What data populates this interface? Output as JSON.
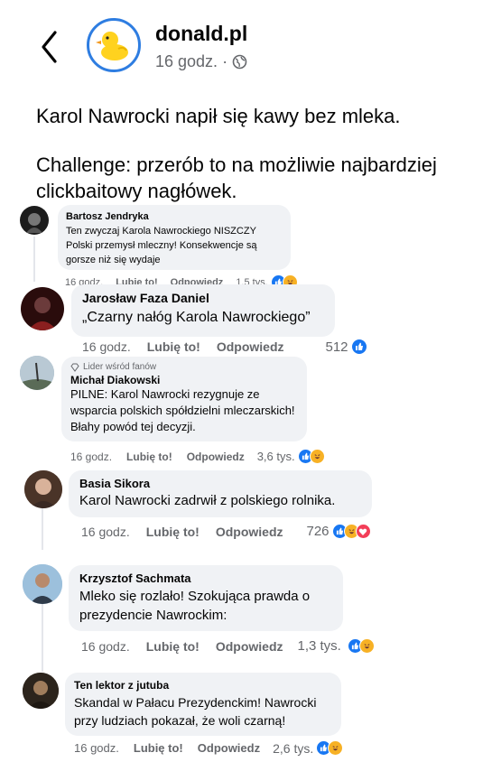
{
  "post": {
    "page_name": "donald.pl",
    "time": "16 godz.",
    "separator": "·",
    "text_line1": "Karol Nawrocki napił się kawy bez mleka.",
    "text_line2": "Challenge: przerób to na możliwie najbardziej clickbaitowy nagłówek."
  },
  "labels": {
    "like": "Lubię to!",
    "reply": "Odpowiedz"
  },
  "comments": [
    {
      "author": "Bartosz Jendryka",
      "text": "Ten zwyczaj Karola Nawrockiego NISZCZY Polski przemysł mleczny! Konsekwencje są gorsze niż się wydaje",
      "time": "16 godz.",
      "count": "1,5 tys.",
      "reactions": [
        "like",
        "haha"
      ]
    },
    {
      "author": "Jarosław Faza Daniel",
      "text": "„Czarny nałóg Karola Nawrockiego”",
      "time": "16 godz.",
      "count": "512",
      "reactions": [
        "like"
      ]
    },
    {
      "author": "Michał Diakowski",
      "badge": "Lider wśród fanów",
      "text": "PILNE: Karol Nawrocki rezygnuje ze wsparcia polskich spółdzielni mleczarskich! Błahy powód tej decyzji.",
      "time": "16 godz.",
      "count": "3,6 tys.",
      "reactions": [
        "like",
        "haha"
      ]
    },
    {
      "author": "Basia Sikora",
      "text": "Karol Nawrocki zadrwił z polskiego rolnika.",
      "time": "16 godz.",
      "count": "726",
      "reactions": [
        "like",
        "haha",
        "love"
      ]
    },
    {
      "author": "Krzysztof Sachmata",
      "text": "Mleko się rozlało! Szokująca prawda o prezydencie Nawrockim:",
      "time": "16 godz.",
      "count": "1,3 tys.",
      "reactions": [
        "like",
        "haha"
      ]
    },
    {
      "author": "Ten lektor z jutuba",
      "text": "Skandal w Pałacu Prezydenckim! Nawrocki przy ludziach pokazał, że woli czarną!",
      "time": "16 godz.",
      "count": "2,6 tys.",
      "reactions": [
        "like",
        "haha"
      ]
    }
  ],
  "colors": {
    "like": "#1877f2",
    "haha": "#f7b125",
    "love": "#f33e58",
    "bubble": "#f0f2f5",
    "secondary_text": "#65676b",
    "avatar_ring": "#2e7de1"
  },
  "icons": {
    "back": "chevron-left-icon",
    "audience": "globe-icon",
    "badge": "diamond-icon"
  }
}
